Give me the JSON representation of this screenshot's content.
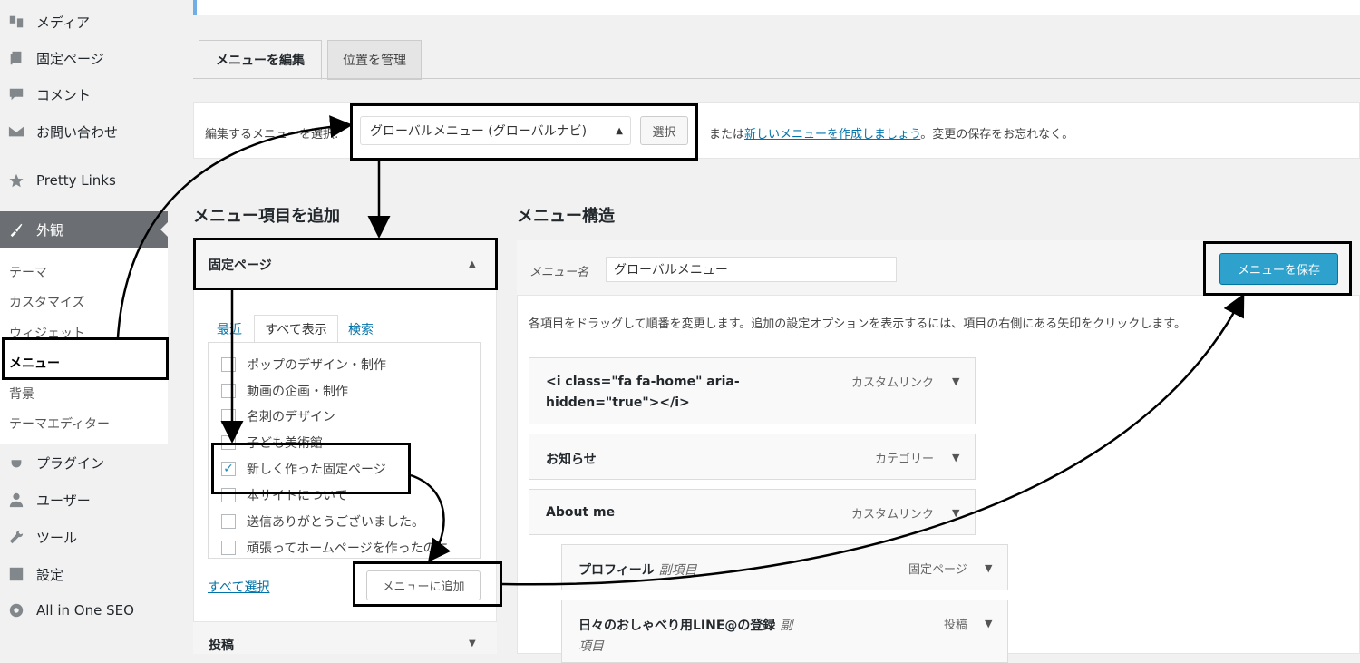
{
  "sidebar": {
    "items": [
      {
        "label": "メディア",
        "icon": "media-icon"
      },
      {
        "label": "固定ページ",
        "icon": "pages-icon"
      },
      {
        "label": "コメント",
        "icon": "comment-icon"
      },
      {
        "label": "お問い合わせ",
        "icon": "mail-icon"
      },
      {
        "label": "Pretty Links",
        "icon": "star-icon"
      },
      {
        "label": "外観",
        "icon": "brush-icon"
      },
      {
        "label": "プラグイン",
        "icon": "plugin-icon"
      },
      {
        "label": "ユーザー",
        "icon": "user-icon"
      },
      {
        "label": "ツール",
        "icon": "wrench-icon"
      },
      {
        "label": "設定",
        "icon": "settings-icon"
      },
      {
        "label": "All in One SEO",
        "icon": "gear-icon"
      }
    ],
    "appearance_sub": [
      "テーマ",
      "カスタマイズ",
      "ウィジェット",
      "メニュー",
      "背景",
      "テーマエディター"
    ]
  },
  "tabs": {
    "edit": "メニューを編集",
    "locations": "位置を管理"
  },
  "select_bar": {
    "prefix": "編集するメニューを選択:",
    "selected": "グローバルメニュー (グローバルナビ)",
    "select_button": "選択",
    "or_text": "または",
    "create_link": "新しいメニューを作成しましょう",
    "suffix": "。変更の保存をお忘れなく。"
  },
  "add_items": {
    "heading": "メニュー項目を追加",
    "section_title": "固定ページ",
    "subtabs": [
      "最近",
      "すべて表示",
      "検索"
    ],
    "pages": [
      {
        "label": "ポップのデザイン・制作",
        "checked": false
      },
      {
        "label": "動画の企画・制作",
        "checked": false
      },
      {
        "label": "名刺のデザイン",
        "checked": false
      },
      {
        "label": "子ども美術館",
        "checked": false
      },
      {
        "label": "新しく作った固定ページ",
        "checked": true
      },
      {
        "label": "本サイトについて",
        "checked": false
      },
      {
        "label": "送信ありがとうございました。",
        "checked": false
      },
      {
        "label": "頑張ってホームページを作ったのに",
        "checked": false
      }
    ],
    "select_all": "すべて選択",
    "add_button": "メニューに追加",
    "posts_title": "投稿"
  },
  "structure": {
    "heading": "メニュー構造",
    "name_label": "メニュー名",
    "name_value": "グローバルメニュー",
    "save_button": "メニューを保存",
    "instructions": "各項目をドラッグして順番を変更します。追加の設定オプションを表示するには、項目の右側にある矢印をクリックします。",
    "items": [
      {
        "title_line1": "<i class=\"fa fa-home\" aria-",
        "title_line2": "hidden=\"true\"></i>",
        "type": "カスタムリンク"
      },
      {
        "title": "お知らせ",
        "type": "カテゴリー"
      },
      {
        "title": "About me",
        "type": "カスタムリンク"
      },
      {
        "title": "プロフィール",
        "subtag": "副項目",
        "type": "固定ページ"
      },
      {
        "title": "日々のおしゃべり用LINE@の登録",
        "subtag": "副",
        "subtag2": "項目",
        "type": "投稿"
      }
    ]
  },
  "colors": {
    "accent": "#0073aa",
    "primary_button": "#2ea2cc",
    "sidebar_active": "#6b6f73"
  }
}
